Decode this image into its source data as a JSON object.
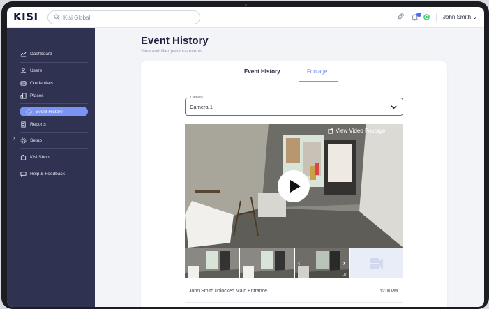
{
  "app": {
    "logo": "KISI"
  },
  "search": {
    "placeholder": "Kisi Global"
  },
  "header": {
    "user_menu": "John Smith ⌄"
  },
  "sidebar": {
    "items": [
      {
        "label": "Dashboard",
        "icon": "chart-line-icon"
      },
      {
        "label": "Users",
        "icon": "user-icon"
      },
      {
        "label": "Credentials",
        "icon": "card-icon"
      },
      {
        "label": "Places",
        "icon": "building-icon"
      },
      {
        "label": "Event History",
        "icon": "clock-icon",
        "active": true
      },
      {
        "label": "Reports",
        "icon": "report-icon"
      },
      {
        "label": "Setup",
        "icon": "gear-icon"
      },
      {
        "label": "Kisi Shop",
        "icon": "bag-icon"
      },
      {
        "label": "Help & Feedback",
        "icon": "chat-icon"
      }
    ]
  },
  "page": {
    "title": "Event History",
    "subtitle": "View and filter previous events"
  },
  "tabs": [
    {
      "label": "Event History"
    },
    {
      "label": "Footage",
      "active": true
    }
  ],
  "camera": {
    "legend": "Camera",
    "value": "Camera 1"
  },
  "video": {
    "link_label": "View Video Footage"
  },
  "thumbnails": {
    "counter": "1/7"
  },
  "event": {
    "text": "John Smith unlocked Main Entrance",
    "time": "12:00 PM"
  },
  "colors": {
    "sidebar": "#2f3351",
    "accent": "#7b93f2",
    "status": "#2bc26a"
  }
}
